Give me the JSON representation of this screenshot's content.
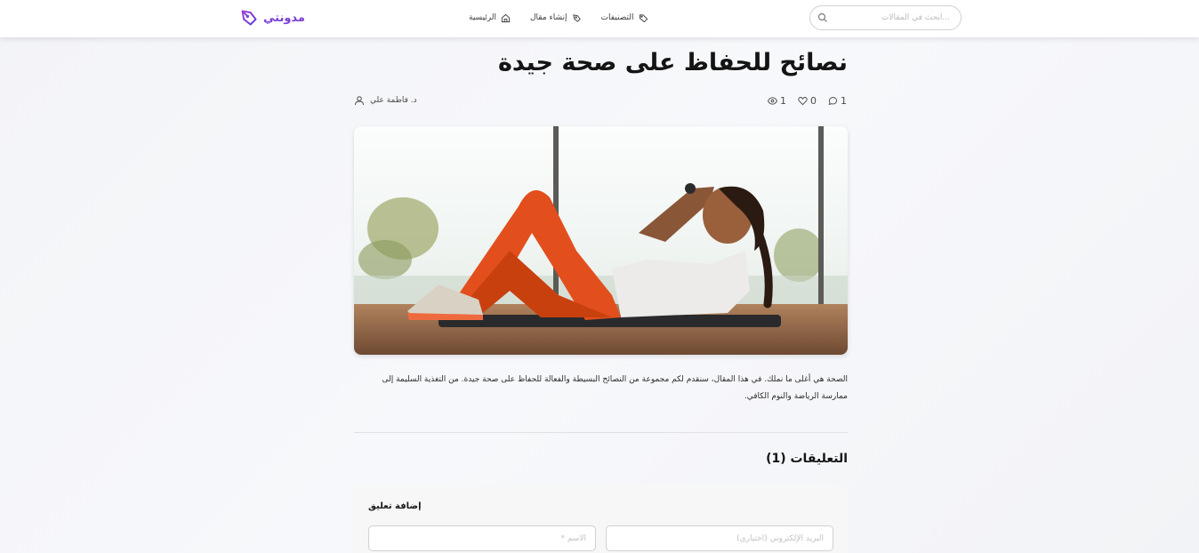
{
  "header": {
    "logo_text": "مدونتي",
    "search_placeholder": "...ابحث في المقالات",
    "nav": [
      {
        "label": "التصنيفات",
        "icon": "tag-icon"
      },
      {
        "label": "إنشاء مقال",
        "icon": "pen-icon"
      },
      {
        "label": "الرئيسية",
        "icon": "home-icon"
      }
    ]
  },
  "article": {
    "title": "نصائح للحفاظ على صحة جيدة",
    "author": "د. فاطمة علي",
    "stats": {
      "comments": "1",
      "likes": "0",
      "views": "1"
    },
    "image": {
      "icon": "article-image"
    },
    "body": "الصحة هي أغلى ما نملك. في هذا المقال، سنقدم لكم مجموعة من النصائح البسيطة والفعالة للحفاظ على صحة جيدة. من التغذية السليمة إلى ممارسة الرياضة والنوم الكافي."
  },
  "comments": {
    "heading": "التعليقات (1)",
    "form": {
      "title": "إضافة تعليق",
      "email_placeholder": "البريد الإلكتروني (اختياري)",
      "name_placeholder": "الاسم *"
    }
  },
  "colors": {
    "brand": "#7a3fd6",
    "text": "#141414",
    "background": "#f3f4f7"
  }
}
